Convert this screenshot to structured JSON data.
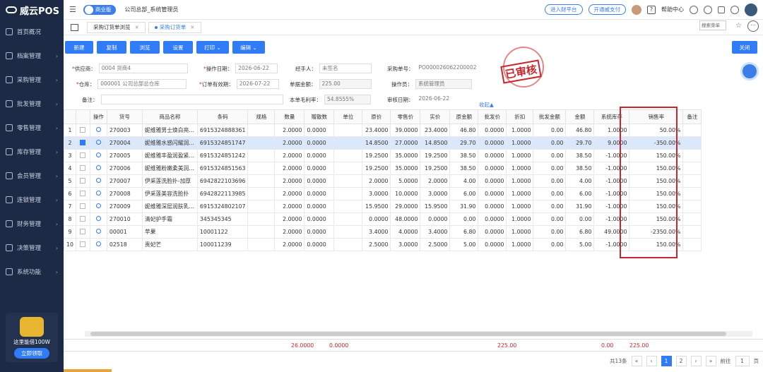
{
  "app": {
    "name": "威云POS"
  },
  "sidebar": {
    "items": [
      {
        "label": "首页概况",
        "icon": "home-icon"
      },
      {
        "label": "档案管理",
        "icon": "archive-icon"
      },
      {
        "label": "采购管理",
        "icon": "purchase-icon"
      },
      {
        "label": "批发管理",
        "icon": "wholesale-icon"
      },
      {
        "label": "零售管理",
        "icon": "retail-icon"
      },
      {
        "label": "库存管理",
        "icon": "inventory-icon"
      },
      {
        "label": "会员管理",
        "icon": "member-icon"
      },
      {
        "label": "连锁管理",
        "icon": "chain-icon"
      },
      {
        "label": "财务管理",
        "icon": "finance-icon"
      },
      {
        "label": "决策管理",
        "icon": "decision-icon"
      },
      {
        "label": "系统功能",
        "icon": "system-icon"
      }
    ],
    "promo": {
      "text": "这里能借100W",
      "button": "立即领取"
    }
  },
  "header": {
    "badge": "商业版",
    "company": "公司总部_系统管理员",
    "links": [
      "进入财平台",
      "开通威支付"
    ],
    "help": "帮助中心"
  },
  "tabs": [
    {
      "label": "采购订货单浏览"
    },
    {
      "label": "采购订货单"
    }
  ],
  "search_menu": "搜索菜单",
  "toolbar": {
    "buttons": [
      "新建",
      "复制",
      "浏览",
      "设置",
      "打印",
      "编辑"
    ],
    "close": "关闭"
  },
  "form": {
    "supplier_label": "供应商：",
    "supplier": "0004 货商4",
    "op_date_label": "操作日期：",
    "op_date": "2026-06-22",
    "handler_label": "经手人：",
    "handler": "未签名",
    "purchase_no_label": "采购单号：",
    "purchase_no": "PO000026062200002",
    "warehouse_label": "仓库：",
    "warehouse": "000001 公司总部总仓库",
    "valid_label": "订单有效期：",
    "valid": "2026-07-22",
    "amount_label": "单据金额：",
    "amount": "225.00",
    "operator_label": "操作员：",
    "operator": "系统管理员",
    "remark_label": "备注：",
    "gross_label": "本单毛利率：",
    "gross": "54.8555%",
    "audit_date_label": "审核日期：",
    "audit_date": "2026-06-22",
    "stamp": "已审核",
    "collapse": "收起▲"
  },
  "table": {
    "headers": [
      "",
      "",
      "操作",
      "货号",
      "商品名称",
      "条码",
      "规格",
      "数量",
      "赠散数",
      "单位",
      "原价",
      "零售价",
      "实价",
      "原金额",
      "批发价",
      "折扣",
      "批发金额",
      "金额",
      "系统库存",
      "销售率",
      "备注"
    ],
    "rows": [
      [
        "1",
        "270003",
        "妮维雅男士焕白亮…",
        "6915324888361",
        "",
        "2.0000",
        "0.0000",
        "",
        "23.4000",
        "39.0000",
        "23.4000",
        "46.80",
        "0.0000",
        "1.0000",
        "0.00",
        "46.80",
        "1.0000",
        "50.00%"
      ],
      [
        "2",
        "270004",
        "妮维雅水感闪耀润…",
        "6915324851747",
        "",
        "2.0000",
        "0.0000",
        "",
        "14.8500",
        "27.0000",
        "14.8500",
        "29.70",
        "0.0000",
        "1.0000",
        "0.00",
        "29.70",
        "9.0000",
        "-350.00%"
      ],
      [
        "3",
        "270005",
        "妮维雅丰盈润盈紧…",
        "6915324851242",
        "",
        "2.0000",
        "0.0000",
        "",
        "19.2500",
        "35.0000",
        "19.2500",
        "38.50",
        "0.0000",
        "1.0000",
        "0.00",
        "38.50",
        "-1.0000",
        "150.00%"
      ],
      [
        "4",
        "270006",
        "妮维雅粉嫩柔美润…",
        "6915324851563",
        "",
        "2.0000",
        "0.0000",
        "",
        "19.2500",
        "35.0000",
        "19.2500",
        "38.50",
        "0.0000",
        "1.0000",
        "0.00",
        "38.50",
        "-1.0000",
        "150.00%"
      ],
      [
        "5",
        "270007",
        "伊采莲洗脸扑-加厚",
        "6942822103696",
        "",
        "2.0000",
        "0.0000",
        "",
        "2.0000",
        "5.0000",
        "2.0000",
        "4.00",
        "0.0000",
        "1.0000",
        "0.00",
        "4.00",
        "-1.0000",
        "150.00%"
      ],
      [
        "6",
        "270008",
        "伊采莲美容洗脸扑",
        "6942822113985",
        "",
        "2.0000",
        "0.0000",
        "",
        "3.0000",
        "10.0000",
        "3.0000",
        "6.00",
        "0.0000",
        "1.0000",
        "0.00",
        "6.00",
        "-1.0000",
        "150.00%"
      ],
      [
        "7",
        "270009",
        "妮维雅深层润肤乳…",
        "6915324802107",
        "",
        "2.0000",
        "0.0000",
        "",
        "15.9500",
        "29.0000",
        "15.9500",
        "31.90",
        "0.0000",
        "1.0000",
        "0.00",
        "31.90",
        "-1.0000",
        "150.00%"
      ],
      [
        "8",
        "270010",
        "清妃护手霜",
        "345345345",
        "",
        "2.0000",
        "0.0000",
        "",
        "0.0000",
        "48.0000",
        "0.0000",
        "0.00",
        "0.0000",
        "1.0000",
        "0.00",
        "0.00",
        "-1.0000",
        "150.00%"
      ],
      [
        "9",
        "00001",
        "苹果",
        "10001122",
        "",
        "2.0000",
        "0.0000",
        "",
        "3.4000",
        "4.0000",
        "3.4000",
        "6.80",
        "0.0000",
        "1.0000",
        "0.00",
        "6.80",
        "49.0000",
        "-2350.00%"
      ],
      [
        "10",
        "02518",
        "贵妃芒",
        "100011239",
        "",
        "2.0000",
        "0.0000",
        "",
        "2.5000",
        "3.0000",
        "2.5000",
        "5.00",
        "0.0000",
        "1.0000",
        "0.00",
        "5.00",
        "-1.0000",
        "150.00%"
      ]
    ],
    "selected_row": 1,
    "totals": {
      "qty": "26.0000",
      "gift": "0.0000",
      "orig_amount": "225.00",
      "wholesale_amount": "0.00",
      "amount": "225.00"
    }
  },
  "pager": {
    "total": "共13条",
    "pages": [
      "1",
      "2"
    ],
    "goto_label": "前往",
    "goto_value": "1",
    "page_suffix": "页"
  }
}
